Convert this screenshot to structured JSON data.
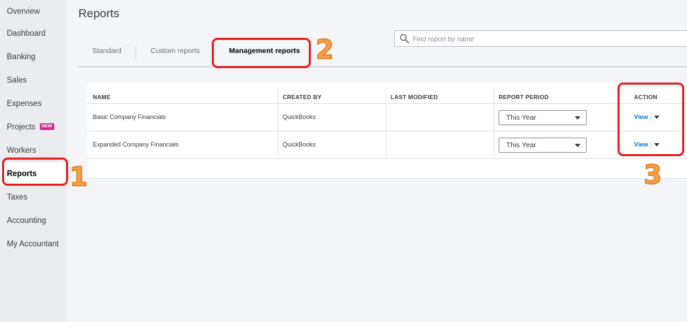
{
  "sidebar": {
    "items": [
      {
        "label": "Overview"
      },
      {
        "label": "Dashboard"
      },
      {
        "label": "Banking"
      },
      {
        "label": "Sales"
      },
      {
        "label": "Expenses"
      },
      {
        "label": "Projects",
        "badge": "NEW"
      },
      {
        "label": "Workers"
      },
      {
        "label": "Reports",
        "active": true
      },
      {
        "label": "Taxes"
      },
      {
        "label": "Accounting"
      },
      {
        "label": "My Accountant"
      }
    ]
  },
  "header": {
    "title": "Reports",
    "search_placeholder": "Find report by name"
  },
  "tabs": [
    {
      "label": "Standard"
    },
    {
      "label": "Custom reports"
    },
    {
      "label": "Management reports",
      "active": true
    }
  ],
  "table": {
    "columns": [
      "NAME",
      "CREATED BY",
      "LAST MODIFIED",
      "REPORT PERIOD",
      "ACTION"
    ],
    "rows": [
      {
        "name": "Basic Company Financials",
        "created_by": "QuickBooks",
        "last_modified": "",
        "report_period": "This Year",
        "action": "View"
      },
      {
        "name": "Expanded Company Financials",
        "created_by": "QuickBooks",
        "last_modified": "",
        "report_period": "This Year",
        "action": "View"
      }
    ]
  },
  "annotations": [
    "1",
    "2",
    "3"
  ],
  "colors": {
    "link": "#0077c5",
    "badge": "#d52b8f",
    "annotation_box": "#e81d1d",
    "annotation_number": "#f5a04a"
  }
}
